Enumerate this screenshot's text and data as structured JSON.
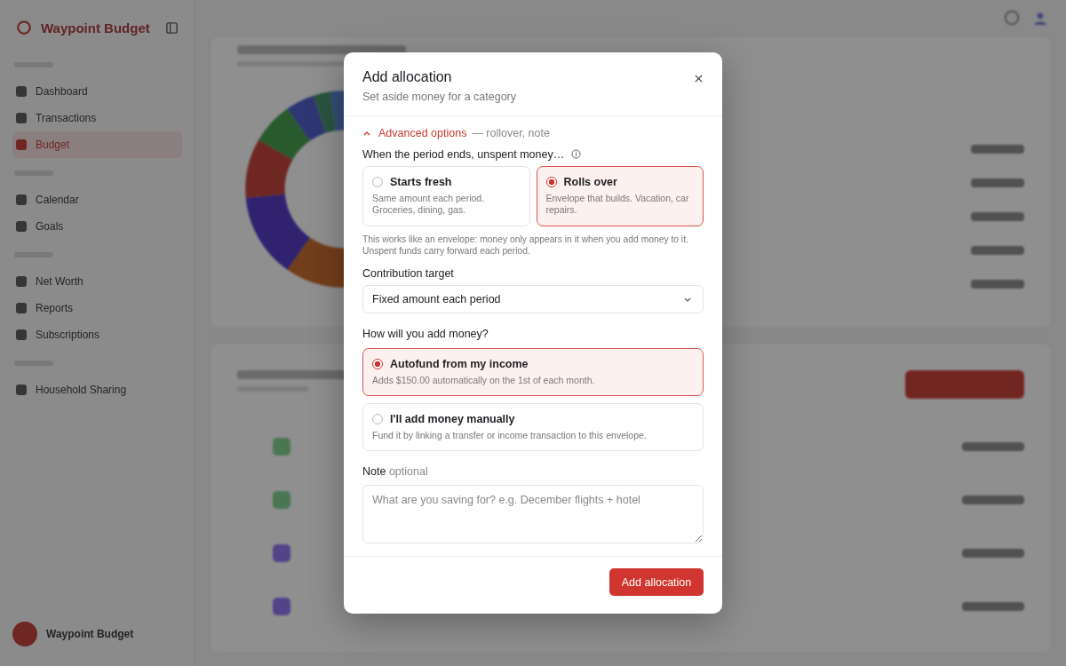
{
  "app": {
    "brand": "Waypoint Budget",
    "nav_groups": [
      {
        "items": [
          {
            "label": "Dashboard",
            "selected": false
          },
          {
            "label": "Transactions",
            "selected": false
          },
          {
            "label": "Budget",
            "selected": true
          }
        ]
      },
      {
        "items": [
          {
            "label": "Calendar",
            "selected": false
          },
          {
            "label": "Goals",
            "selected": false
          }
        ]
      },
      {
        "items": [
          {
            "label": "Net Worth",
            "selected": false
          },
          {
            "label": "Reports",
            "selected": false
          },
          {
            "label": "Subscriptions",
            "selected": false
          }
        ]
      },
      {
        "items": [
          {
            "label": "Household Sharing",
            "selected": false
          }
        ]
      }
    ],
    "user": "Waypoint Budget"
  },
  "dialog": {
    "title": "Add allocation",
    "subtitle": "Set aside money for a category",
    "advanced": {
      "label": "Advanced options",
      "hint": "— rollover, note",
      "expanded": true
    },
    "rollover": {
      "label": "When the period ends, unspent money…",
      "options": [
        {
          "title": "Starts fresh",
          "description": "Same amount each period. Groceries, dining, gas.",
          "selected": false
        },
        {
          "title": "Rolls over",
          "description": "Envelope that builds. Vacation, car repairs.",
          "selected": true
        }
      ],
      "help": "This works like an envelope: money only appears in it when you add money to it. Unspent funds carry forward each period."
    },
    "contribution": {
      "label": "Contribution target",
      "value": "Fixed amount each period"
    },
    "funding": {
      "label": "How will you add money?",
      "options": [
        {
          "title": "Autofund from my income",
          "description": "Adds $150.00 automatically on the 1st of each month.",
          "selected": true
        },
        {
          "title": "I'll add money manually",
          "description": "Fund it by linking a transfer or income transaction to this envelope.",
          "selected": false
        }
      ]
    },
    "note": {
      "label": "Note",
      "optional": "optional",
      "placeholder": "What are you saving for? e.g. December flights + hotel"
    },
    "submit": "Add allocation"
  }
}
